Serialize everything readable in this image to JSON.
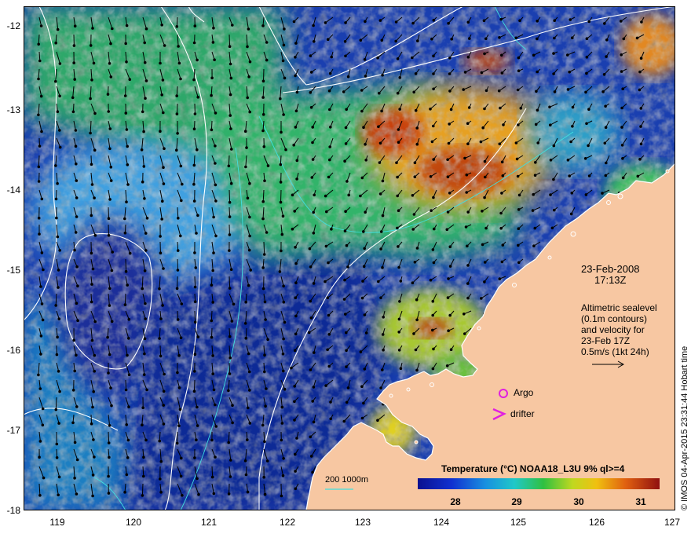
{
  "map": {
    "lat_ticks": [
      "-12",
      "-13",
      "-14",
      "-15",
      "-16",
      "-17",
      "-18"
    ],
    "lon_ticks": [
      "119",
      "120",
      "121",
      "122",
      "123",
      "124",
      "125",
      "126",
      "127"
    ],
    "lat_range": [
      -18,
      -11.8
    ],
    "lon_range": [
      118.6,
      127
    ]
  },
  "info": {
    "date": "23-Feb-2008",
    "time": "17:13Z",
    "altimetry_lines": [
      "Altimetric sealevel",
      "(0.1m contours)",
      "and velocity for",
      "23-Feb 17Z",
      "0.5m/s (1kt 24h)"
    ]
  },
  "legend": {
    "argo_label": "Argo",
    "drifter_label": "drifter",
    "bathymetry_label": "200  1000m"
  },
  "colorbar": {
    "title": "Temperature (°C) NOAA18_L3U 9% ql>=4",
    "ticks": [
      "28",
      "29",
      "30",
      "31"
    ],
    "range": [
      27.4,
      31.3
    ]
  },
  "credit": "© IMOS 04-Apr-2015 23:31:44 Hobart time",
  "colors": {
    "land": "#f7c7a2",
    "argo": "#e020e0",
    "drifter": "#e020e0",
    "contour": "#ffffff",
    "bathymetry": "#40e0e0"
  }
}
